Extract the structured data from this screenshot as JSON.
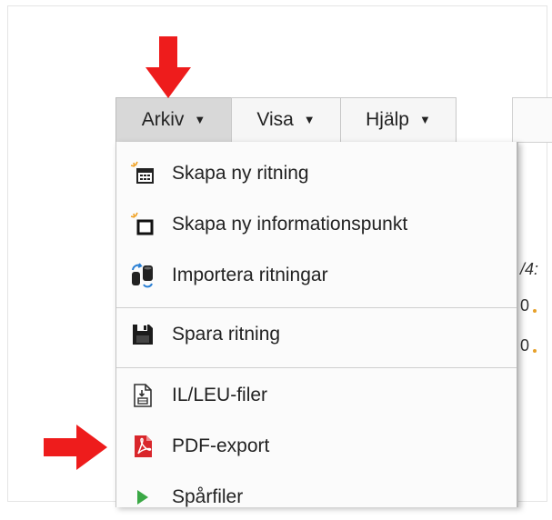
{
  "menubar": {
    "tabs": [
      {
        "label": "Arkiv"
      },
      {
        "label": "Visa"
      },
      {
        "label": "Hjälp"
      }
    ],
    "caret": "▼"
  },
  "menu": {
    "items": [
      {
        "label": "Skapa ny ritning",
        "icon": "new-drawing-icon"
      },
      {
        "label": "Skapa ny informationspunkt",
        "icon": "new-infopoint-icon"
      },
      {
        "label": "Importera ritningar",
        "icon": "import-icon"
      },
      {
        "label": "Spara ritning",
        "icon": "save-icon"
      },
      {
        "label": "IL/LEU-filer",
        "icon": "file-icon"
      },
      {
        "label": "PDF-export",
        "icon": "pdf-icon"
      },
      {
        "label": "Spårfiler",
        "icon": "track-file-icon"
      }
    ]
  },
  "background": {
    "fragments": [
      "/4:",
      "0",
      "0"
    ]
  },
  "colors": {
    "arrow": "#ee1c1c",
    "active_tab": "#d8d8d8",
    "pdf_red": "#d9262b"
  }
}
